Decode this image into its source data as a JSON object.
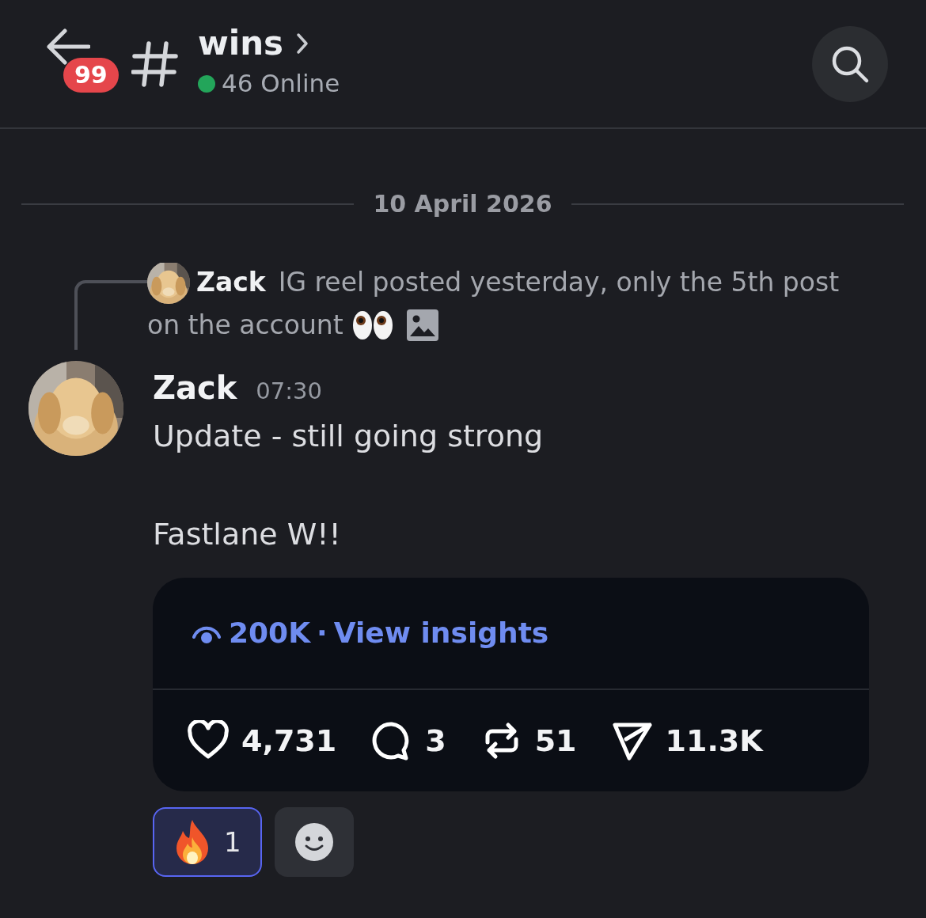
{
  "header": {
    "unread_badge": "99",
    "channel": "wins",
    "online": "46 Online"
  },
  "date_divider": "10 April 2026",
  "reply": {
    "author": "Zack",
    "lines": [
      "IG reel posted yesterday, only the 5th post",
      "on the account"
    ]
  },
  "message": {
    "author": "Zack",
    "time": "07:30",
    "paragraphs": [
      "Update - still going strong",
      "Fastlane W!!"
    ]
  },
  "embed": {
    "views": "200K",
    "separator": "·",
    "link": "View insights",
    "stats": [
      {
        "kind": "likes",
        "count": "4,731"
      },
      {
        "kind": "comments",
        "count": "3"
      },
      {
        "kind": "reposts",
        "count": "51"
      },
      {
        "kind": "shares",
        "count": "11.3K"
      }
    ]
  },
  "reactions": [
    {
      "kind": "fire",
      "count": "1",
      "selected": true
    }
  ]
}
